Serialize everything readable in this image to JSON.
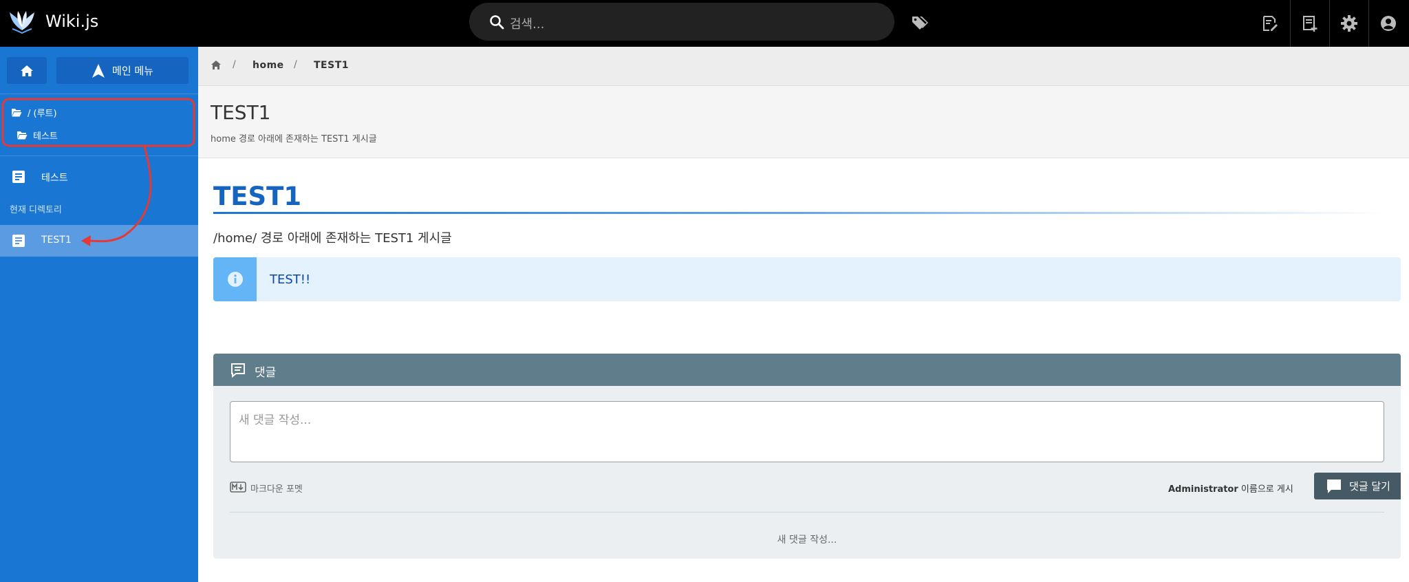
{
  "header": {
    "app_title": "Wiki.js",
    "search_placeholder": "검색..."
  },
  "sidebar": {
    "menu_label": "메인 메뉴",
    "folders": [
      {
        "label": "/ (루트)"
      },
      {
        "label": "테스트"
      }
    ],
    "pages": [
      {
        "label": "테스트"
      }
    ],
    "current_dir_label": "현재 디렉토리",
    "current_pages": [
      {
        "label": "TEST1",
        "active": true
      }
    ]
  },
  "breadcrumb": {
    "items": [
      "home",
      "TEST1"
    ]
  },
  "page": {
    "title": "TEST1",
    "description": "home 경로 아래에 존재하는 TEST1 게시글",
    "heading": "TEST1",
    "paragraph": "/home/ 경로 아래에 존재하는 TEST1 게시글",
    "callout_text": "TEST!!"
  },
  "comments": {
    "title": "댓글",
    "placeholder": "새 댓글 작성...",
    "markdown_label": "마크다운 포멧",
    "post_as_user": "Administrator",
    "post_as_suffix": " 이름으로 게시",
    "post_button": "댓글 달기",
    "empty_text": "새 댓글 작성..."
  },
  "colors": {
    "sidebar_bg": "#1976d2",
    "accent": "#1565c0",
    "annotation": "#e53935",
    "callout_bg": "#e3f2fd",
    "comments_header": "#607d8b"
  }
}
